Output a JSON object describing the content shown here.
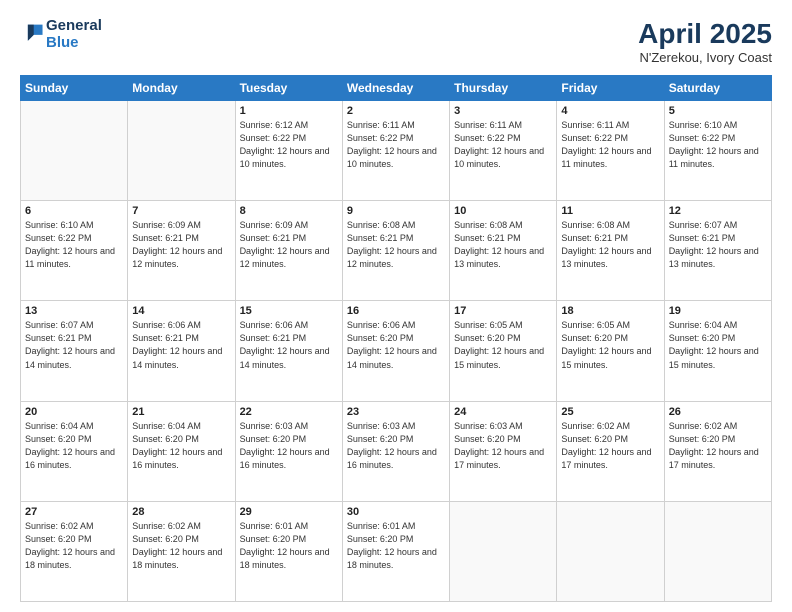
{
  "header": {
    "logo_line1": "General",
    "logo_line2": "Blue",
    "month_year": "April 2025",
    "location": "N'Zerekou, Ivory Coast"
  },
  "weekdays": [
    "Sunday",
    "Monday",
    "Tuesday",
    "Wednesday",
    "Thursday",
    "Friday",
    "Saturday"
  ],
  "weeks": [
    [
      {
        "day": "",
        "detail": ""
      },
      {
        "day": "",
        "detail": ""
      },
      {
        "day": "1",
        "detail": "Sunrise: 6:12 AM\nSunset: 6:22 PM\nDaylight: 12 hours and 10 minutes."
      },
      {
        "day": "2",
        "detail": "Sunrise: 6:11 AM\nSunset: 6:22 PM\nDaylight: 12 hours and 10 minutes."
      },
      {
        "day": "3",
        "detail": "Sunrise: 6:11 AM\nSunset: 6:22 PM\nDaylight: 12 hours and 10 minutes."
      },
      {
        "day": "4",
        "detail": "Sunrise: 6:11 AM\nSunset: 6:22 PM\nDaylight: 12 hours and 11 minutes."
      },
      {
        "day": "5",
        "detail": "Sunrise: 6:10 AM\nSunset: 6:22 PM\nDaylight: 12 hours and 11 minutes."
      }
    ],
    [
      {
        "day": "6",
        "detail": "Sunrise: 6:10 AM\nSunset: 6:22 PM\nDaylight: 12 hours and 11 minutes."
      },
      {
        "day": "7",
        "detail": "Sunrise: 6:09 AM\nSunset: 6:21 PM\nDaylight: 12 hours and 12 minutes."
      },
      {
        "day": "8",
        "detail": "Sunrise: 6:09 AM\nSunset: 6:21 PM\nDaylight: 12 hours and 12 minutes."
      },
      {
        "day": "9",
        "detail": "Sunrise: 6:08 AM\nSunset: 6:21 PM\nDaylight: 12 hours and 12 minutes."
      },
      {
        "day": "10",
        "detail": "Sunrise: 6:08 AM\nSunset: 6:21 PM\nDaylight: 12 hours and 13 minutes."
      },
      {
        "day": "11",
        "detail": "Sunrise: 6:08 AM\nSunset: 6:21 PM\nDaylight: 12 hours and 13 minutes."
      },
      {
        "day": "12",
        "detail": "Sunrise: 6:07 AM\nSunset: 6:21 PM\nDaylight: 12 hours and 13 minutes."
      }
    ],
    [
      {
        "day": "13",
        "detail": "Sunrise: 6:07 AM\nSunset: 6:21 PM\nDaylight: 12 hours and 14 minutes."
      },
      {
        "day": "14",
        "detail": "Sunrise: 6:06 AM\nSunset: 6:21 PM\nDaylight: 12 hours and 14 minutes."
      },
      {
        "day": "15",
        "detail": "Sunrise: 6:06 AM\nSunset: 6:21 PM\nDaylight: 12 hours and 14 minutes."
      },
      {
        "day": "16",
        "detail": "Sunrise: 6:06 AM\nSunset: 6:20 PM\nDaylight: 12 hours and 14 minutes."
      },
      {
        "day": "17",
        "detail": "Sunrise: 6:05 AM\nSunset: 6:20 PM\nDaylight: 12 hours and 15 minutes."
      },
      {
        "day": "18",
        "detail": "Sunrise: 6:05 AM\nSunset: 6:20 PM\nDaylight: 12 hours and 15 minutes."
      },
      {
        "day": "19",
        "detail": "Sunrise: 6:04 AM\nSunset: 6:20 PM\nDaylight: 12 hours and 15 minutes."
      }
    ],
    [
      {
        "day": "20",
        "detail": "Sunrise: 6:04 AM\nSunset: 6:20 PM\nDaylight: 12 hours and 16 minutes."
      },
      {
        "day": "21",
        "detail": "Sunrise: 6:04 AM\nSunset: 6:20 PM\nDaylight: 12 hours and 16 minutes."
      },
      {
        "day": "22",
        "detail": "Sunrise: 6:03 AM\nSunset: 6:20 PM\nDaylight: 12 hours and 16 minutes."
      },
      {
        "day": "23",
        "detail": "Sunrise: 6:03 AM\nSunset: 6:20 PM\nDaylight: 12 hours and 16 minutes."
      },
      {
        "day": "24",
        "detail": "Sunrise: 6:03 AM\nSunset: 6:20 PM\nDaylight: 12 hours and 17 minutes."
      },
      {
        "day": "25",
        "detail": "Sunrise: 6:02 AM\nSunset: 6:20 PM\nDaylight: 12 hours and 17 minutes."
      },
      {
        "day": "26",
        "detail": "Sunrise: 6:02 AM\nSunset: 6:20 PM\nDaylight: 12 hours and 17 minutes."
      }
    ],
    [
      {
        "day": "27",
        "detail": "Sunrise: 6:02 AM\nSunset: 6:20 PM\nDaylight: 12 hours and 18 minutes."
      },
      {
        "day": "28",
        "detail": "Sunrise: 6:02 AM\nSunset: 6:20 PM\nDaylight: 12 hours and 18 minutes."
      },
      {
        "day": "29",
        "detail": "Sunrise: 6:01 AM\nSunset: 6:20 PM\nDaylight: 12 hours and 18 minutes."
      },
      {
        "day": "30",
        "detail": "Sunrise: 6:01 AM\nSunset: 6:20 PM\nDaylight: 12 hours and 18 minutes."
      },
      {
        "day": "",
        "detail": ""
      },
      {
        "day": "",
        "detail": ""
      },
      {
        "day": "",
        "detail": ""
      }
    ]
  ]
}
